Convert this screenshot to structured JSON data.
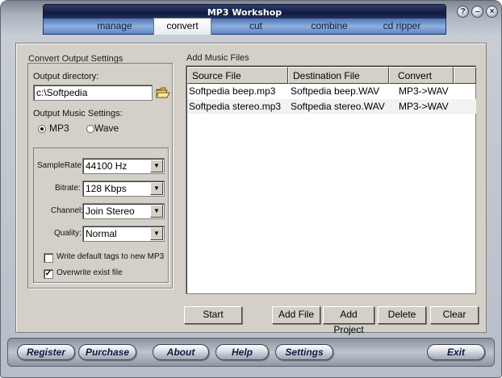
{
  "window": {
    "title": "MP3 Workshop"
  },
  "tabs": [
    {
      "label": "manage"
    },
    {
      "label": "convert"
    },
    {
      "label": "cut"
    },
    {
      "label": "combine"
    },
    {
      "label": "cd ripper"
    }
  ],
  "active_tab": "convert",
  "convert_settings": {
    "group_title": "Convert Output Settings",
    "output_directory_label": "Output directory:",
    "output_directory_value": "c:\\Softpedia",
    "output_music_settings_label": "Output Music Settings:",
    "format_options": [
      {
        "label": "MP3",
        "selected": true
      },
      {
        "label": "Wave",
        "selected": false
      }
    ],
    "samplerate_label": "SampleRate:",
    "samplerate_value": "44100 Hz",
    "bitrate_label": "Bitrate:",
    "bitrate_value": "128 Kbps",
    "channel_label": "Channel:",
    "channel_value": "Join Stereo",
    "quality_label": "Quality:",
    "quality_value": "Normal",
    "write_tags_label": "Write default tags to new MP3",
    "write_tags_checked": false,
    "overwrite_label": "Overwrite exist file",
    "overwrite_checked": true
  },
  "music_files": {
    "group_title": "Add Music Files",
    "columns": [
      "Source File",
      "Destination File",
      "Convert"
    ],
    "rows": [
      [
        "Softpedia beep.mp3",
        "Softpedia beep.WAV",
        "MP3->WAV"
      ],
      [
        "Softpedia stereo.mp3",
        "Softpedia stereo.WAV",
        "MP3->WAV"
      ]
    ]
  },
  "actions": {
    "start": "Start",
    "add_file": "Add File",
    "add_project": "Add Project",
    "delete": "Delete",
    "clear": "Clear"
  },
  "bottom_buttons": {
    "register": "Register",
    "purchase": "Purchase",
    "about": "About",
    "help": "Help",
    "settings": "Settings",
    "exit": "Exit"
  },
  "window_controls": {
    "help": "?",
    "minimize": "–",
    "close": "×"
  },
  "colors": {
    "title_plate": "#111a3d",
    "tabstrip": "#5f86c4",
    "panel": "#d4d0c8"
  }
}
